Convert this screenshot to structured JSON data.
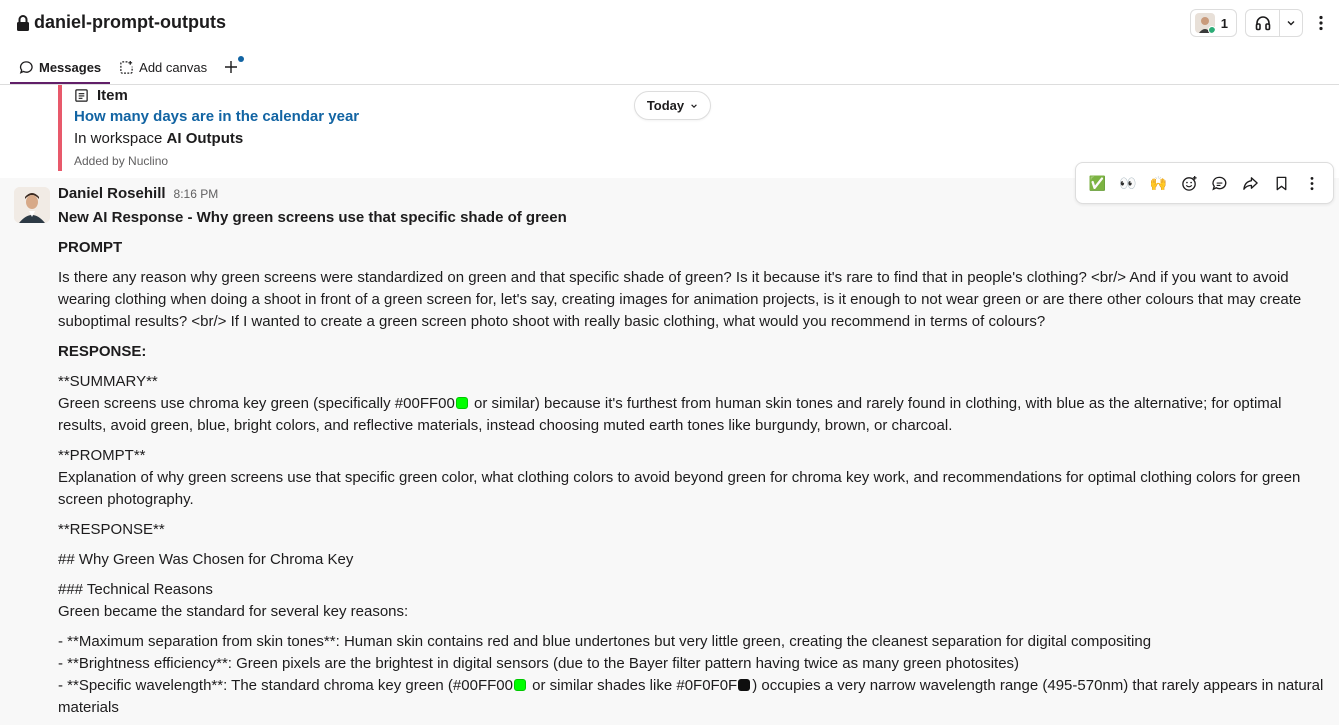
{
  "header": {
    "channel_name": "daniel-prompt-outputs",
    "member_count": "1"
  },
  "tabs": [
    {
      "label": "Messages"
    },
    {
      "label": "Add canvas"
    }
  ],
  "attachment": {
    "type_label": "Item",
    "link_title": "How many days are in the calendar year",
    "workspace_prefix": "In workspace ",
    "workspace_name": "AI Outputs",
    "added_by": "Added by Nuclino"
  },
  "date_divider": {
    "label": "Today"
  },
  "message": {
    "author": "Daniel Rosehill",
    "time": "8:16 PM",
    "title": "New AI Response - Why green screens use that specific shade of green",
    "prompt_heading": "PROMPT",
    "prompt_text": "Is there any reason why green screens were standardized on green and that specific shade of green? Is it because it's rare to find that in people's clothing? <br/> And if you want to avoid wearing clothing when doing a shoot in front of a green screen for, let's say, creating images for animation projects, is it enough to not wear green or are there other colours that may create suboptimal results? <br/> If I wanted to create a green screen photo shoot with really basic clothing, what would you recommend in terms of colours?",
    "response_heading": "RESPONSE:",
    "summary_heading": "**SUMMARY**",
    "summary_pre": "Green screens use chroma key green (specifically #00FF00",
    "summary_post": " or similar) because it's furthest from human skin tones and rarely found in clothing, with blue as the alternative; for optimal results, avoid green, blue, bright colors, and reflective materials, instead choosing muted earth tones like burgundy, brown, or charcoal.",
    "prompt2_heading": "**PROMPT**",
    "prompt2_text": "Explanation of why green screens use that specific green color, what clothing colors to avoid beyond green for chroma key work, and recommendations for optimal clothing colors for green screen photography.",
    "response2_heading": "**RESPONSE**",
    "h2": "## Why Green Was Chosen for Chroma Key",
    "h3": "### Technical Reasons",
    "intro": "Green became the standard for several key reasons:",
    "bullet1": "- **Maximum separation from skin tones**: Human skin contains red and blue undertones but very little green, creating the cleanest separation for digital compositing",
    "bullet2": "- **Brightness efficiency**: Green pixels are the brightest in digital sensors (due to the Bayer filter pattern having twice as many green photosites)",
    "bullet3_pre": "- **Specific wavelength**: The standard chroma key green (#00FF00",
    "bullet3_mid": " or similar shades like #0F0F0F",
    "bullet3_post": ") occupies a very narrow wavelength range (495-570nm) that rarely appears in natural materials"
  },
  "colors": {
    "swatch_green": "#00FF00",
    "swatch_dark": "#0F0F0F",
    "link": "#1264a3",
    "attachment_bar": "#e8596b",
    "active_tab": "#611f69"
  },
  "icons": {
    "reaction_1": "✅",
    "reaction_2": "👀",
    "reaction_3": "🙌"
  }
}
